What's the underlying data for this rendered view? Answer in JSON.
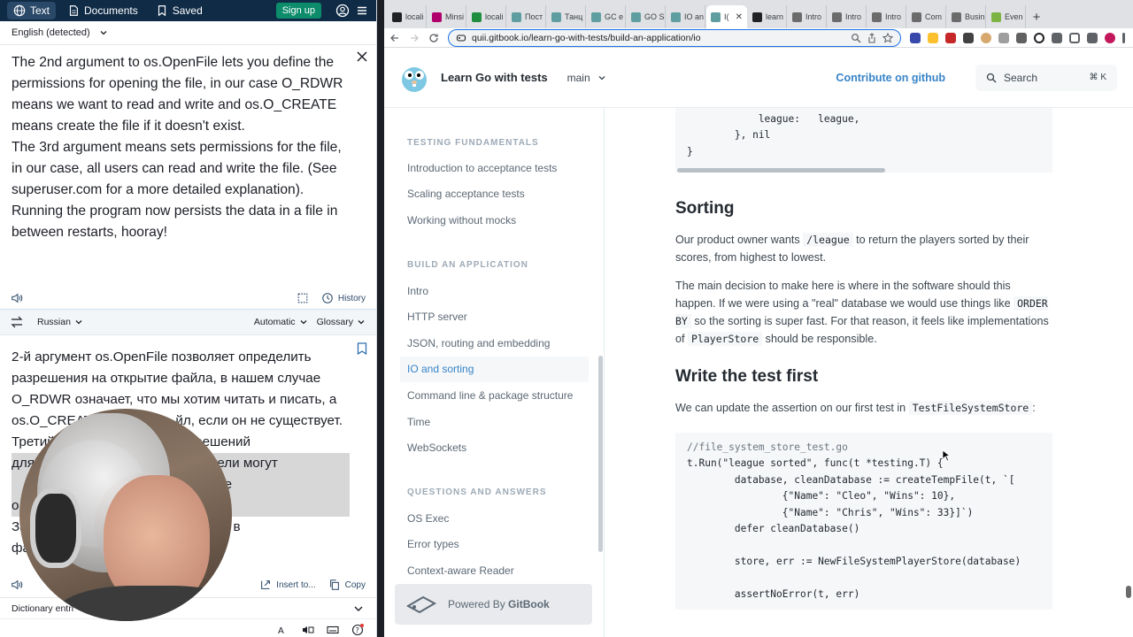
{
  "translator": {
    "tabs": [
      {
        "label": "Text",
        "icon": "globe-icon"
      },
      {
        "label": "Documents",
        "icon": "document-icon"
      },
      {
        "label": "Saved",
        "icon": "bookmark-icon"
      }
    ],
    "signup_label": "Sign up",
    "source_lang": "English (detected)",
    "source_text": "The 2nd argument to os.OpenFile lets you define the permissions for opening the file, in our case O_RDWR means we want to read and write and os.O_CREATE means create the file if it doesn't exist.\nThe 3rd argument means sets permissions for the file, in our case, all users can read and write the file. (See superuser.com for a more detailed explanation).\nRunning the program now persists the data in a file in between restarts, hooray!",
    "history_label": "History",
    "target_lang": "Russian",
    "formality_label": "Automatic",
    "glossary_label": "Glossary",
    "target_lines": [
      "2-й аргумент os.OpenFile позволяет определить",
      "разрешения на открытие файла, в нашем случае",
      "O_RDWR означает, что мы хотим читать и писать, а",
      "os.O_CREATE                    йл, если он не существует.",
      "Третий                  тановку разрешений",
      "для                                  ользователи могут",
      "                                         подробное",
      "о                                          .com).",
      "За                                   ает данные в",
      "фа                                   а!"
    ],
    "insert_label": "Insert to...",
    "copy_label": "Copy",
    "dictionary_label": "Dictionary entri"
  },
  "browser": {
    "tabs": [
      {
        "label": "locali",
        "color": "#202124"
      },
      {
        "label": "Minsi",
        "color": "#b0006b"
      },
      {
        "label": "locali",
        "color": "#1e8e3e"
      },
      {
        "label": "Пост",
        "color": "#5f9ea0"
      },
      {
        "label": "Танц",
        "color": "#5f9ea0"
      },
      {
        "label": "GC e",
        "color": "#5f9ea0"
      },
      {
        "label": "GO S",
        "color": "#5f9ea0"
      },
      {
        "label": "IO an",
        "color": "#5f9ea0"
      },
      {
        "label": "I(",
        "color": "#5f9ea0",
        "active": true
      },
      {
        "label": "learn",
        "color": "#202124"
      },
      {
        "label": "Intro",
        "color": "#6b6b6b"
      },
      {
        "label": "Intro",
        "color": "#6b6b6b"
      },
      {
        "label": "Intro",
        "color": "#6b6b6b"
      },
      {
        "label": "Com",
        "color": "#6b6b6b"
      },
      {
        "label": "Busin",
        "color": "#6b6b6b"
      },
      {
        "label": "Even",
        "color": "#7cb342"
      }
    ],
    "url": "quii.gitbook.io/learn-go-with-tests/build-an-application/io"
  },
  "gitbook": {
    "title": "Learn Go with tests",
    "branch": "main",
    "contribute": "Contribute on github",
    "search_placeholder": "Search",
    "search_shortcut": "⌘  K",
    "sidebar": [
      {
        "type": "section",
        "label": "TESTING FUNDAMENTALS"
      },
      {
        "type": "item",
        "label": "Introduction to acceptance tests"
      },
      {
        "type": "item",
        "label": "Scaling acceptance tests"
      },
      {
        "type": "item",
        "label": "Working without mocks"
      },
      {
        "type": "gap"
      },
      {
        "type": "section",
        "label": "BUILD AN APPLICATION"
      },
      {
        "type": "item",
        "label": "Intro"
      },
      {
        "type": "item",
        "label": "HTTP server"
      },
      {
        "type": "item",
        "label": "JSON, routing and embedding"
      },
      {
        "type": "item",
        "label": "IO and sorting",
        "active": true
      },
      {
        "type": "item",
        "label": "Command line & package structure"
      },
      {
        "type": "item",
        "label": "Time"
      },
      {
        "type": "item",
        "label": "WebSockets"
      },
      {
        "type": "gap"
      },
      {
        "type": "section",
        "label": "QUESTIONS AND ANSWERS"
      },
      {
        "type": "item",
        "label": "OS Exec"
      },
      {
        "type": "item",
        "label": "Error types"
      },
      {
        "type": "item",
        "label": "Context-aware Reader"
      }
    ],
    "powered_prefix": "Powered By",
    "powered_brand": "GitBook",
    "code_top": "            league:   league,\n        }, nil\n}",
    "sorting_heading": "Sorting",
    "sorting_p1_a": "Our product owner wants ",
    "sorting_p1_code": "/league",
    "sorting_p1_b": " to return the players sorted by their scores, from highest to lowest.",
    "sorting_p2_a": "The main decision to make here is where in the software should this happen. If we were using a \"real\" database we would use things like ",
    "sorting_p2_code1": "ORDER BY",
    "sorting_p2_b": " so the sorting is super fast. For that reason, it feels like implementations of ",
    "sorting_p2_code2": "PlayerStore",
    "sorting_p2_c": " should be responsible.",
    "test_heading": "Write the test first",
    "test_p_a": "We can update the assertion on our first test in ",
    "test_p_code": "TestFileSystemStore",
    "test_p_b": ":",
    "code_bottom": [
      {
        "cls": "cm",
        "text": "//file_system_store_test.go"
      },
      {
        "cls": "",
        "text": "t.Run(\"league sorted\", func(t *testing.T) {"
      },
      {
        "cls": "",
        "text": "        database, cleanDatabase := createTempFile(t, `["
      },
      {
        "cls": "",
        "text": "                {\"Name\": \"Cleo\", \"Wins\": 10},"
      },
      {
        "cls": "",
        "text": "                {\"Name\": \"Chris\", \"Wins\": 33}]`)"
      },
      {
        "cls": "",
        "text": "        defer cleanDatabase()"
      },
      {
        "cls": "",
        "text": ""
      },
      {
        "cls": "",
        "text": "        store, err := NewFileSystemPlayerStore(database)"
      },
      {
        "cls": "",
        "text": ""
      },
      {
        "cls": "",
        "text": "        assertNoError(t, err)"
      }
    ]
  }
}
